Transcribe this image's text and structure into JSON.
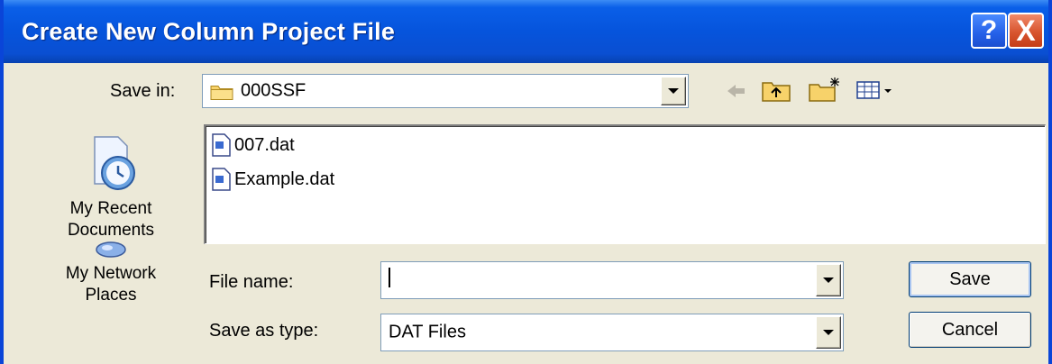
{
  "window": {
    "title": "Create New Column Project File",
    "help_label": "?",
    "close_label": "X"
  },
  "save_in": {
    "label": "Save in:",
    "value": "000SSF"
  },
  "places": {
    "recent": "My Recent Documents",
    "network": "My Network Places"
  },
  "files": [
    {
      "name": "007.dat"
    },
    {
      "name": "Example.dat"
    }
  ],
  "file_name": {
    "label": "File name:",
    "value": ""
  },
  "save_as_type": {
    "label": "Save as type:",
    "value": "DAT Files"
  },
  "buttons": {
    "save": "Save",
    "cancel": "Cancel"
  }
}
